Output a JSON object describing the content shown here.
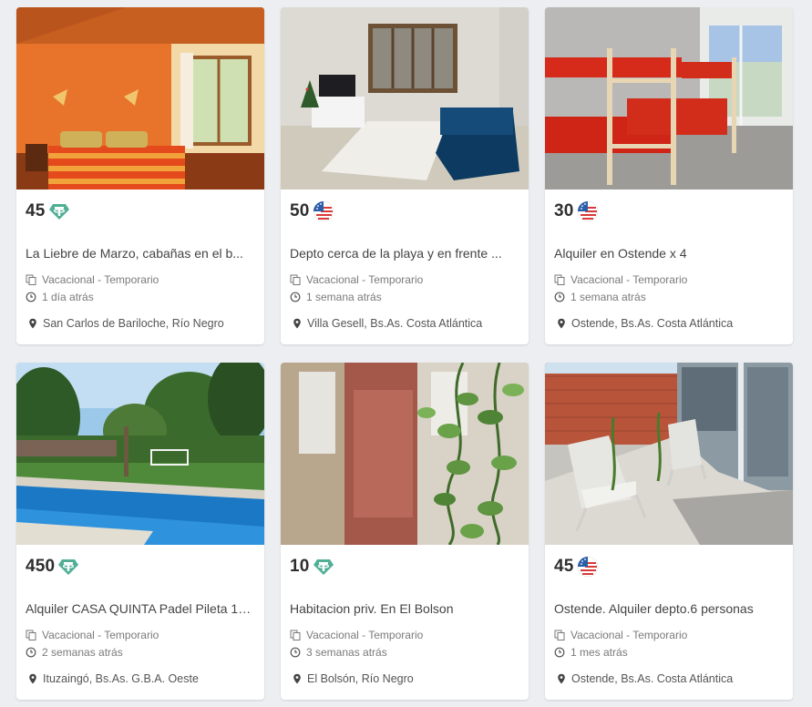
{
  "listings": [
    {
      "price": "45",
      "currency_icon": "tether-usdt-icon",
      "title": "La Liebre de Marzo, cabañas en el b...",
      "category": "Vacacional - Temporario",
      "posted": "1 día atrás",
      "location": "San Carlos de Bariloche, Río Negro",
      "photo": "cabin-bedroom-photo"
    },
    {
      "price": "50",
      "currency_icon": "usd-flag-icon",
      "title": "Depto cerca de la playa y en frente ...",
      "category": "Vacacional - Temporario",
      "posted": "1 semana atrás",
      "location": "Villa Gesell, Bs.As. Costa Atlántica",
      "photo": "living-room-photo"
    },
    {
      "price": "30",
      "currency_icon": "usd-flag-icon",
      "title": "Alquiler en Ostende x 4",
      "category": "Vacacional - Temporario",
      "posted": "1 semana atrás",
      "location": "Ostende, Bs.As. Costa Atlántica",
      "photo": "bunk-beds-photo"
    },
    {
      "price": "450",
      "currency_icon": "tether-usdt-icon",
      "title": "Alquiler CASA QUINTA Padel Pileta 1e...",
      "category": "Vacacional - Temporario",
      "posted": "2 semanas atrás",
      "location": "Ituzaingó, Bs.As. G.B.A. Oeste",
      "photo": "pool-garden-photo"
    },
    {
      "price": "10",
      "currency_icon": "tether-usdt-icon",
      "title": "Habitacion priv. En El Bolson",
      "category": "Vacacional - Temporario",
      "posted": "3 semanas atrás",
      "location": "El Bolsón, Río Negro",
      "photo": "plant-window-photo"
    },
    {
      "price": "45",
      "currency_icon": "usd-flag-icon",
      "title": "Ostende. Alquiler depto.6 personas",
      "category": "Vacacional - Temporario",
      "posted": "1 mes atrás",
      "location": "Ostende, Bs.As. Costa Atlántica",
      "photo": "patio-chairs-photo"
    }
  ],
  "colors": {
    "page_background": "#eceef1",
    "card_background": "#ffffff",
    "tether_green": "#50af95",
    "meta_gray": "#7a7a7a"
  }
}
